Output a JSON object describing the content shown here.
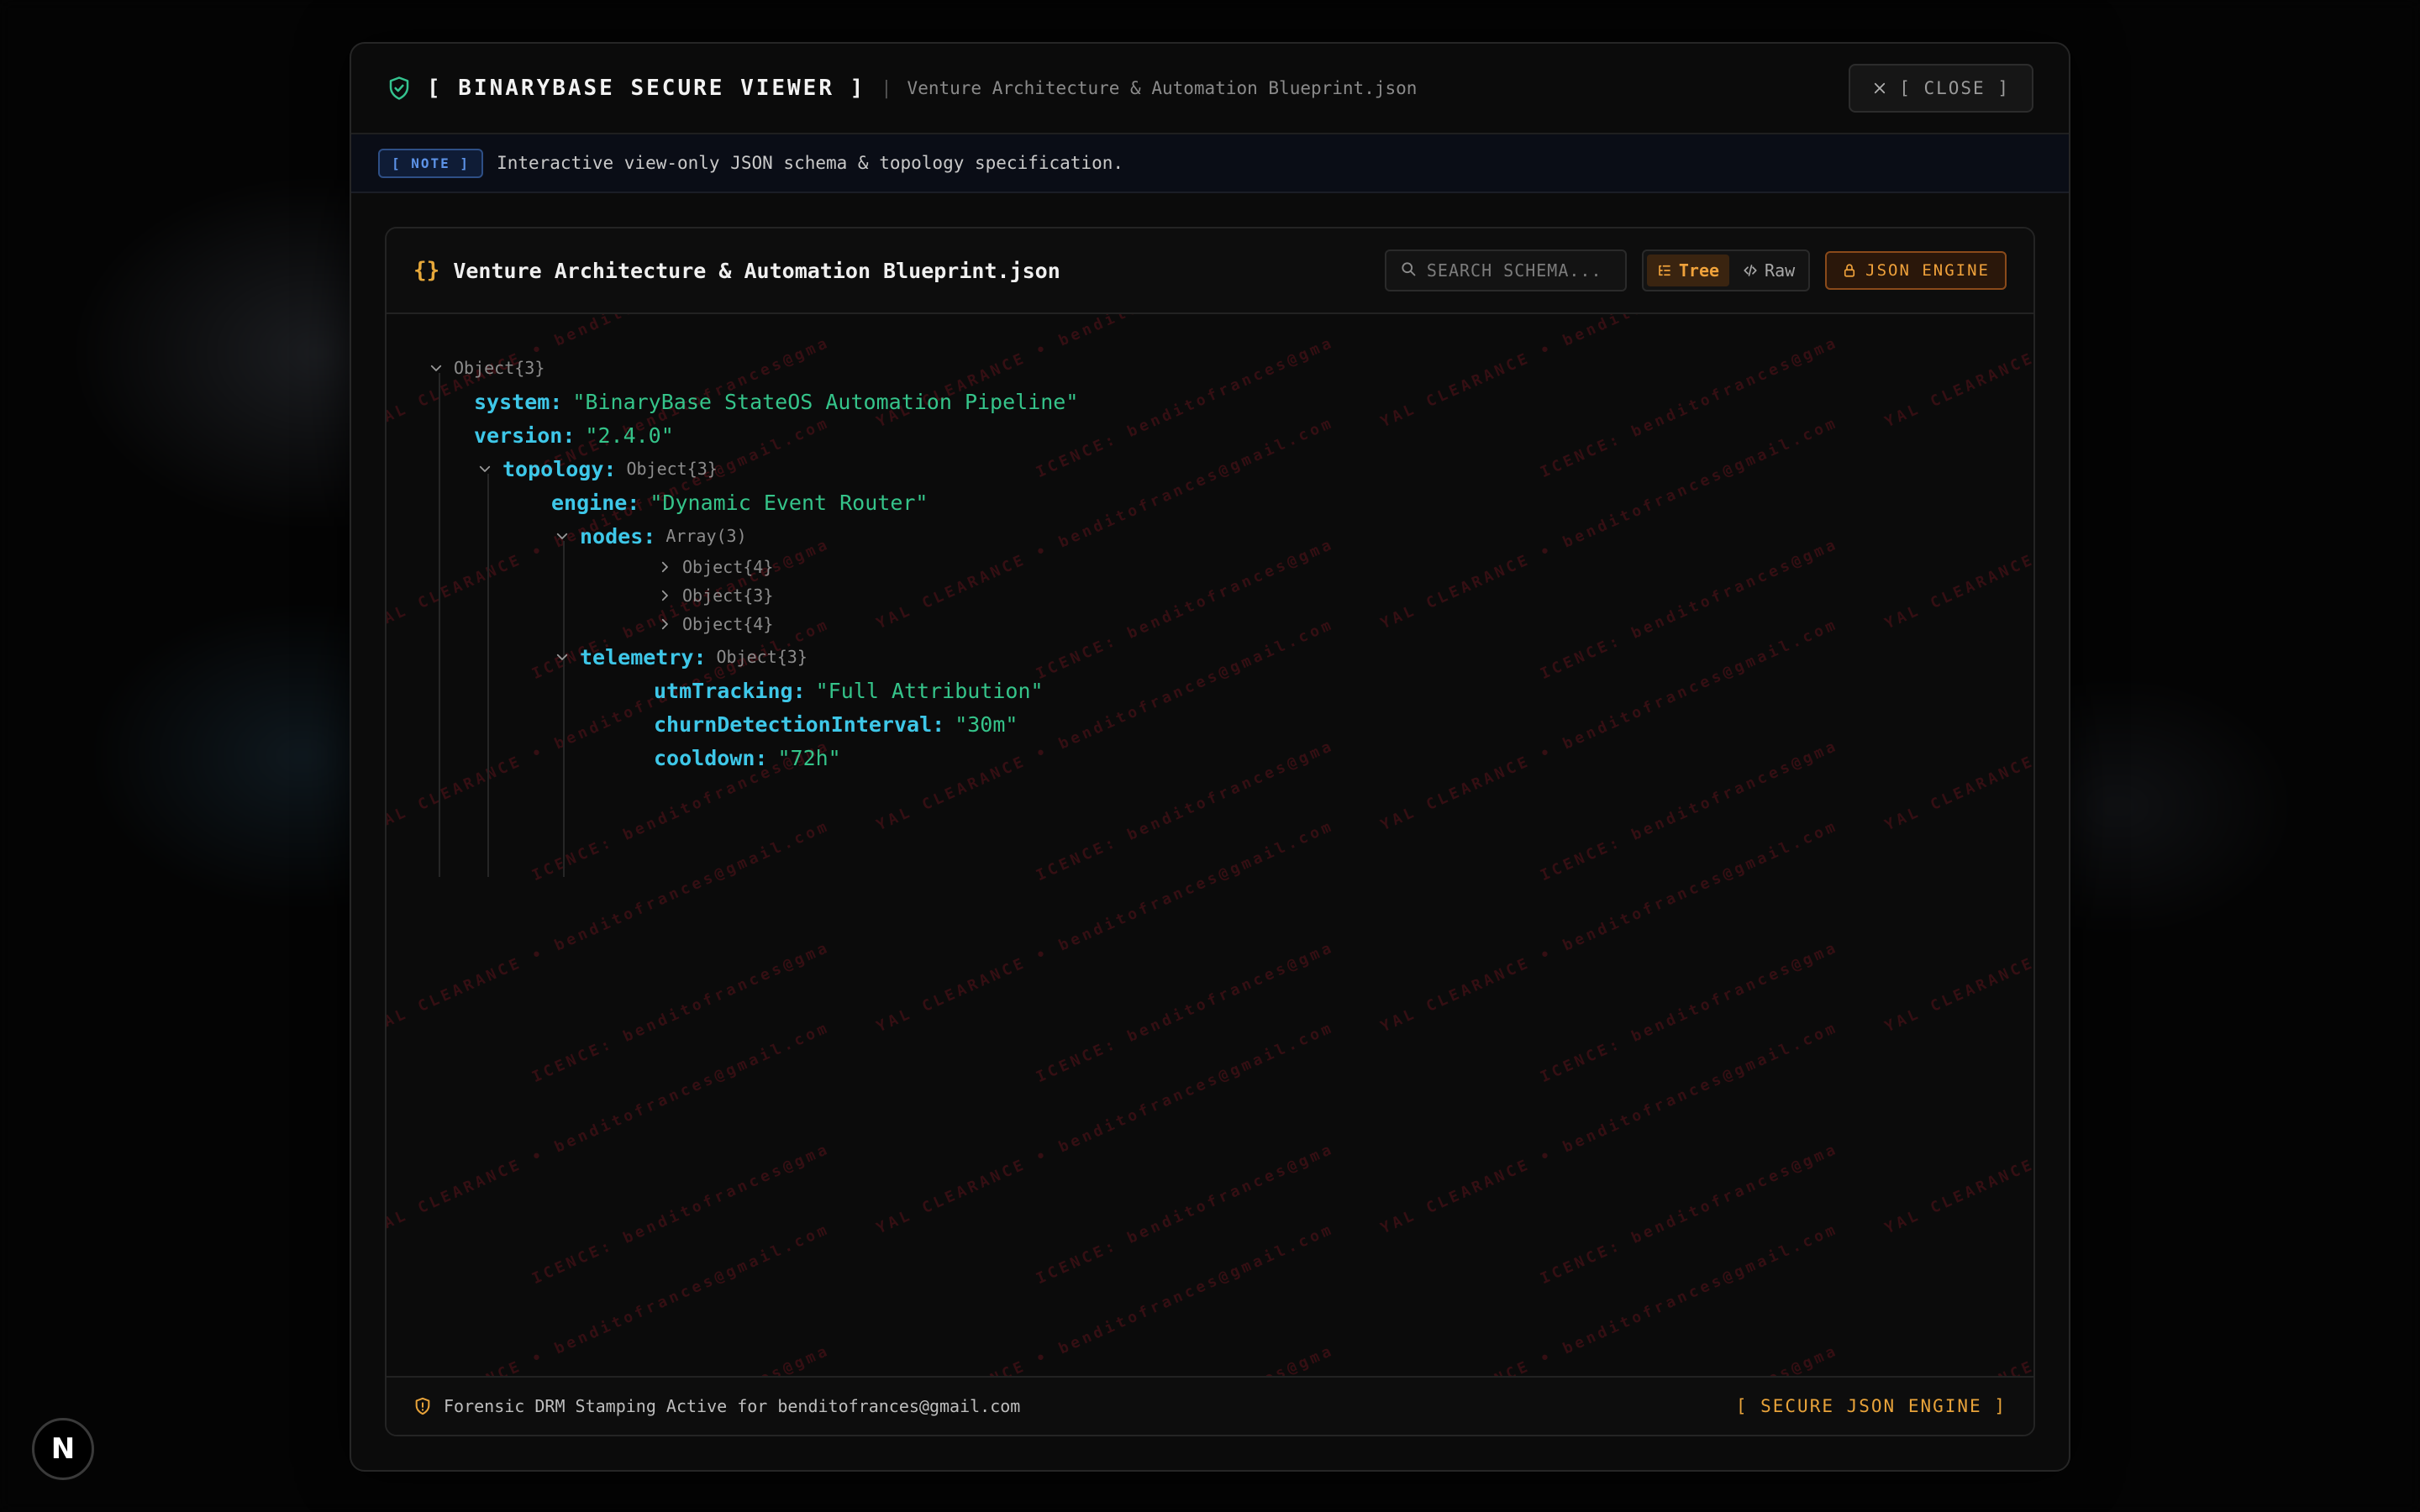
{
  "modal": {
    "app_title": "[ BINARYBASE SECURE VIEWER ]",
    "separator": "|",
    "file_subtitle": "Venture Architecture & Automation Blueprint.json",
    "close_label": "[ CLOSE ]"
  },
  "note": {
    "badge": "[ NOTE ]",
    "text": "Interactive view-only JSON schema & topology specification."
  },
  "panel": {
    "braces": "{}",
    "title": "Venture Architecture & Automation Blueprint.json",
    "search_placeholder": "SEARCH SCHEMA...",
    "view_tree": "Tree",
    "view_raw": "Raw",
    "active_view": "Tree",
    "engine_label": "JSON ENGINE"
  },
  "tree": {
    "root_meta": "Object{3}",
    "system_key": "system:",
    "system_value": "\"BinaryBase StateOS Automation Pipeline\"",
    "version_key": "version:",
    "version_value": "\"2.4.0\"",
    "topology_key": "topology:",
    "topology_meta": "Object{3}",
    "engine_key": "engine:",
    "engine_value": "\"Dynamic Event Router\"",
    "nodes_key": "nodes:",
    "nodes_meta": "Array(3)",
    "node_items": [
      "Object{4}",
      "Object{3}",
      "Object{4}"
    ],
    "telemetry_key": "telemetry:",
    "telemetry_meta": "Object{3}",
    "utm_key": "utmTracking:",
    "utm_value": "\"Full Attribution\"",
    "churn_key": "churnDetectionInterval:",
    "churn_value": "\"30m\"",
    "cooldown_key": "cooldown:",
    "cooldown_value": "\"72h\""
  },
  "watermark": {
    "text": "YAL CLEARANCE • benditofrances@gmail.com",
    "text_alt": "ICENCE: benditofrances@gma",
    "color": "#8c1923"
  },
  "footer": {
    "drm_text": "Forensic DRM Stamping Active for benditofrances@gmail.com",
    "engine_text": "[ SECURE JSON ENGINE ]"
  },
  "badge": {
    "letter": "N"
  },
  "colors": {
    "accent_orange": "#f0a23b",
    "key_cyan": "#3ec7e8",
    "string_green": "#35c48a",
    "shield_green": "#34c38f",
    "note_blue": "#5d93e8"
  }
}
